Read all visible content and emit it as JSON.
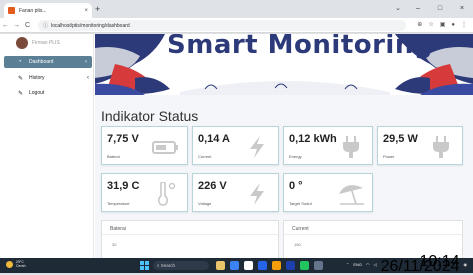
{
  "browser": {
    "tab_title": "Fanan ptis...",
    "tab_close": "×",
    "new_tab": "+",
    "url": "localhost/ptis/monitoring/dashboard",
    "nav": {
      "back": "←",
      "forward": "→",
      "reload": "C"
    },
    "window_controls": {
      "minimize": "–",
      "maximize": "□",
      "close": "×"
    },
    "tab_search": "⌄"
  },
  "sidebar": {
    "user_name": "Firman PLIS",
    "items": [
      {
        "label": "Dashboard",
        "icon": "dashboard-icon",
        "glyph": "◔",
        "active": true
      },
      {
        "label": "History",
        "icon": "edit-icon",
        "glyph": "✎",
        "active": false
      },
      {
        "label": "Logout",
        "icon": "edit-icon",
        "glyph": "✎",
        "active": false
      }
    ]
  },
  "banner": {
    "title": "Smart Monitoring"
  },
  "section_title": "Indikator Status",
  "cards": [
    {
      "value": "7,75 V",
      "label": "Baterai",
      "icon": "battery-icon"
    },
    {
      "value": "0,14 A",
      "label": "Current",
      "icon": "bolt-icon"
    },
    {
      "value": "0,12 kWh",
      "label": "Energy",
      "icon": "plug-icon"
    },
    {
      "value": "29,5 W",
      "label": "Power",
      "icon": "plug-icon"
    },
    {
      "value": "31,9 C",
      "label": "Temperature",
      "icon": "thermometer-icon"
    },
    {
      "value": "226 V",
      "label": "Voltage",
      "icon": "bolt-icon"
    },
    {
      "value": "0 °",
      "label": "Target Sudut",
      "icon": "umbrella-icon"
    }
  ],
  "panels": [
    {
      "title": "Baterai",
      "sub": "30"
    },
    {
      "title": "Current",
      "sub": "150"
    }
  ],
  "taskbar": {
    "weather_temp": "29°C",
    "weather_desc": "Cerah",
    "search_placeholder": "Search",
    "time": "10:14",
    "date": "26/11/2024",
    "lang": "ENG",
    "colors": {
      "accent": "#5b7f95",
      "card_border": "#b8d4db"
    }
  }
}
